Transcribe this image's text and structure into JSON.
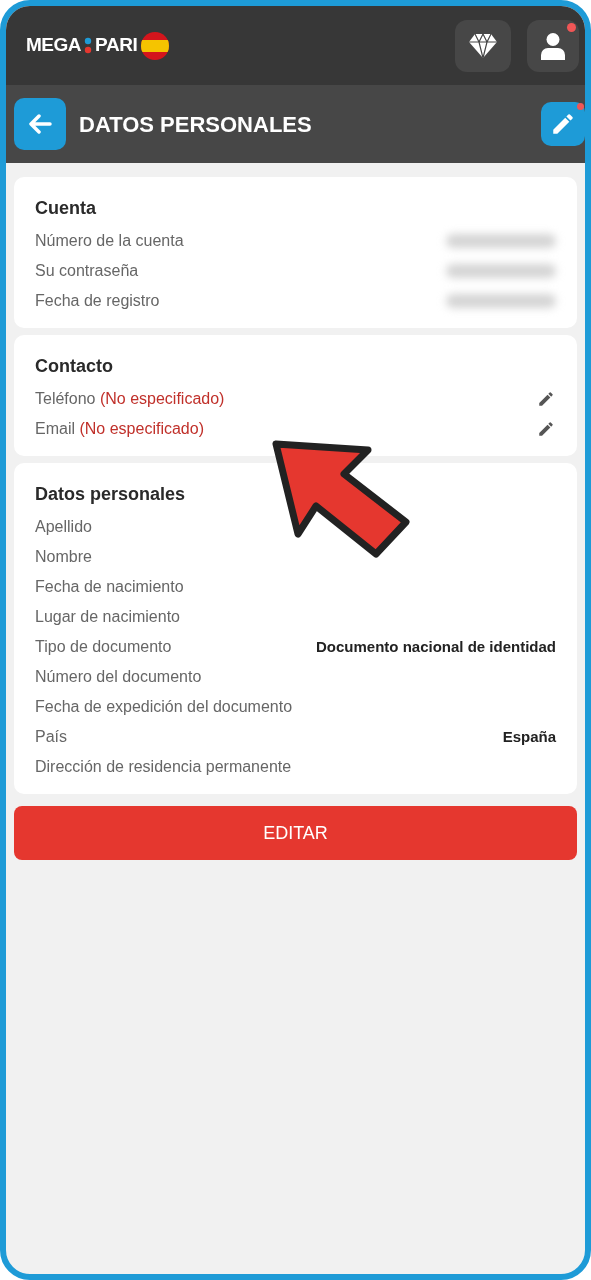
{
  "header": {
    "logo_left": "MEGA",
    "logo_right": "PARI",
    "diamond_notification": false,
    "profile_notification": true
  },
  "subheader": {
    "title": "DATOS PERSONALES",
    "edit_notification": true
  },
  "sections": [
    {
      "title": "Cuenta",
      "rows": [
        {
          "kind": "hidden",
          "label": "Número de la cuenta"
        },
        {
          "kind": "hidden",
          "label": "Su contraseña"
        },
        {
          "kind": "hidden",
          "label": "Fecha de registro"
        }
      ]
    },
    {
      "title": "Contacto",
      "rows": [
        {
          "kind": "missing",
          "label": "Teléfono",
          "status": "(No especificado)",
          "editable": true
        },
        {
          "kind": "missing",
          "label": "Email",
          "status": "(No especificado)",
          "editable": true
        }
      ]
    },
    {
      "title": "Datos personales",
      "rows": [
        {
          "kind": "value",
          "label": "Apellido"
        },
        {
          "kind": "value",
          "label": "Nombre"
        },
        {
          "kind": "value",
          "label": "Fecha de nacimiento"
        },
        {
          "kind": "value",
          "label": "Lugar de nacimiento"
        },
        {
          "kind": "value",
          "label": "Tipo de documento",
          "value": "Documento nacional de identidad"
        },
        {
          "kind": "value",
          "label": "Número del documento"
        },
        {
          "kind": "value",
          "label": "Fecha de expedición del documento"
        },
        {
          "kind": "value",
          "label": "País",
          "value": "España"
        },
        {
          "kind": "value",
          "label": "Dirección de residencia permanente"
        }
      ]
    }
  ],
  "edit_button": "EDITAR",
  "annotation": {
    "kind": "arrow"
  }
}
